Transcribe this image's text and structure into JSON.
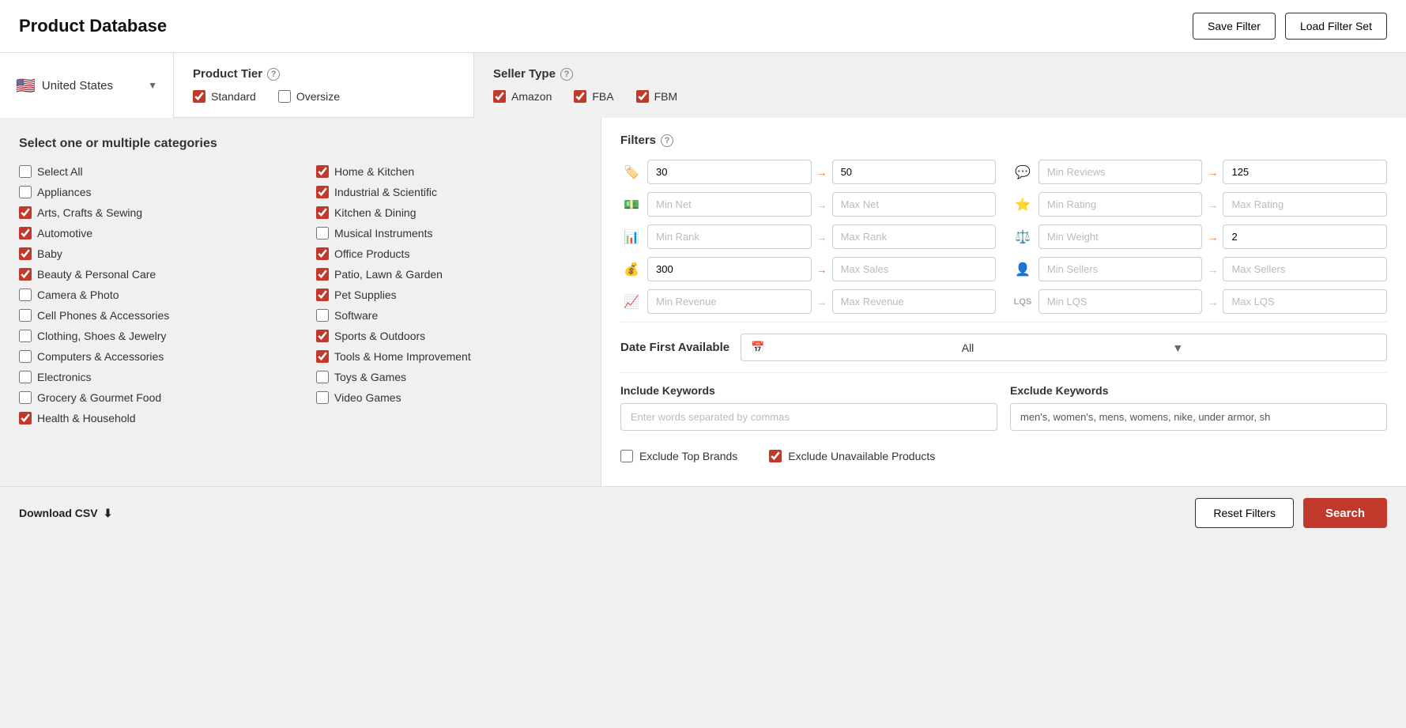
{
  "header": {
    "title": "Product Database",
    "save_filter": "Save Filter",
    "load_filter_set": "Load Filter Set"
  },
  "country": {
    "name": "United States",
    "flag": "🇺🇸"
  },
  "product_tier": {
    "title": "Product Tier",
    "options": [
      {
        "label": "Standard",
        "checked": true
      },
      {
        "label": "Oversize",
        "checked": false
      }
    ]
  },
  "seller_type": {
    "title": "Seller Type",
    "options": [
      {
        "label": "Amazon",
        "checked": true
      },
      {
        "label": "FBA",
        "checked": true
      },
      {
        "label": "FBM",
        "checked": true
      }
    ]
  },
  "categories": {
    "title": "Select one or multiple categories",
    "items": [
      {
        "label": "Select All",
        "checked": false
      },
      {
        "label": "Home & Kitchen",
        "checked": true
      },
      {
        "label": "Appliances",
        "checked": false
      },
      {
        "label": "Industrial & Scientific",
        "checked": true
      },
      {
        "label": "Arts, Crafts & Sewing",
        "checked": true
      },
      {
        "label": "Kitchen & Dining",
        "checked": true
      },
      {
        "label": "Automotive",
        "checked": true
      },
      {
        "label": "Musical Instruments",
        "checked": false
      },
      {
        "label": "Baby",
        "checked": true
      },
      {
        "label": "Office Products",
        "checked": true
      },
      {
        "label": "Beauty & Personal Care",
        "checked": true
      },
      {
        "label": "Patio, Lawn & Garden",
        "checked": true
      },
      {
        "label": "Camera & Photo",
        "checked": false
      },
      {
        "label": "Pet Supplies",
        "checked": true
      },
      {
        "label": "Cell Phones & Accessories",
        "checked": false
      },
      {
        "label": "Software",
        "checked": false
      },
      {
        "label": "Clothing, Shoes & Jewelry",
        "checked": false
      },
      {
        "label": "Sports & Outdoors",
        "checked": true
      },
      {
        "label": "Computers & Accessories",
        "checked": false
      },
      {
        "label": "Tools & Home Improvement",
        "checked": true
      },
      {
        "label": "Electronics",
        "checked": false
      },
      {
        "label": "Toys & Games",
        "checked": false
      },
      {
        "label": "Grocery & Gourmet Food",
        "checked": false
      },
      {
        "label": "Video Games",
        "checked": false
      },
      {
        "label": "Health & Household",
        "checked": true
      }
    ]
  },
  "filters": {
    "title": "Filters",
    "rows": [
      {
        "icon": "🏷️",
        "icon_name": "price-icon",
        "min_val": "30",
        "max_val": "50",
        "arrow": "→",
        "icon2": "💬",
        "icon2_name": "reviews-icon",
        "min2_placeholder": "Min Reviews",
        "max2_val": "125",
        "arrow2": "→"
      },
      {
        "icon": "💵",
        "icon_name": "net-icon",
        "min_placeholder": "Min Net",
        "max_placeholder": "Max Net",
        "arrow": "→",
        "icon2": "⭐",
        "icon2_name": "rating-icon",
        "min2_placeholder": "Min Rating",
        "max2_placeholder": "Max Rating",
        "arrow2": "→"
      },
      {
        "icon": "📊",
        "icon_name": "rank-icon",
        "min_placeholder": "Min Rank",
        "max_placeholder": "Max Rank",
        "arrow": "→",
        "icon2": "⚖️",
        "icon2_name": "weight-icon",
        "min2_placeholder": "Min Weight",
        "max2_val": "2",
        "arrow2": "→"
      },
      {
        "icon": "💰",
        "icon_name": "sales-icon",
        "min_val": "300",
        "max_placeholder": "Max Sales",
        "arrow": "→",
        "icon2": "👤",
        "icon2_name": "sellers-icon",
        "min2_placeholder": "Min Sellers",
        "max2_placeholder": "Max Sellers",
        "arrow2": "→"
      },
      {
        "icon": "📈",
        "icon_name": "revenue-icon",
        "min_placeholder": "Min Revenue",
        "max_placeholder": "Max Revenue",
        "arrow": "→",
        "icon2_text": "LQS",
        "icon2_name": "lqs-icon",
        "min2_placeholder": "Min LQS",
        "max2_placeholder": "Max LQS",
        "arrow2": "→"
      }
    ]
  },
  "date_first_available": {
    "label": "Date First Available",
    "value": "All"
  },
  "keywords": {
    "include": {
      "label": "Include Keywords",
      "placeholder": "Enter words separated by commas",
      "value": ""
    },
    "exclude": {
      "label": "Exclude Keywords",
      "placeholder": "",
      "value": "men's, women's, mens, womens, nike, under armor, sh"
    }
  },
  "bottom_filters": {
    "exclude_top_brands": {
      "label": "Exclude Top Brands",
      "checked": false
    },
    "exclude_unavailable": {
      "label": "Exclude Unavailable Products",
      "checked": true
    }
  },
  "footer": {
    "download_csv": "Download CSV",
    "reset_filters": "Reset Filters",
    "search": "Search"
  }
}
